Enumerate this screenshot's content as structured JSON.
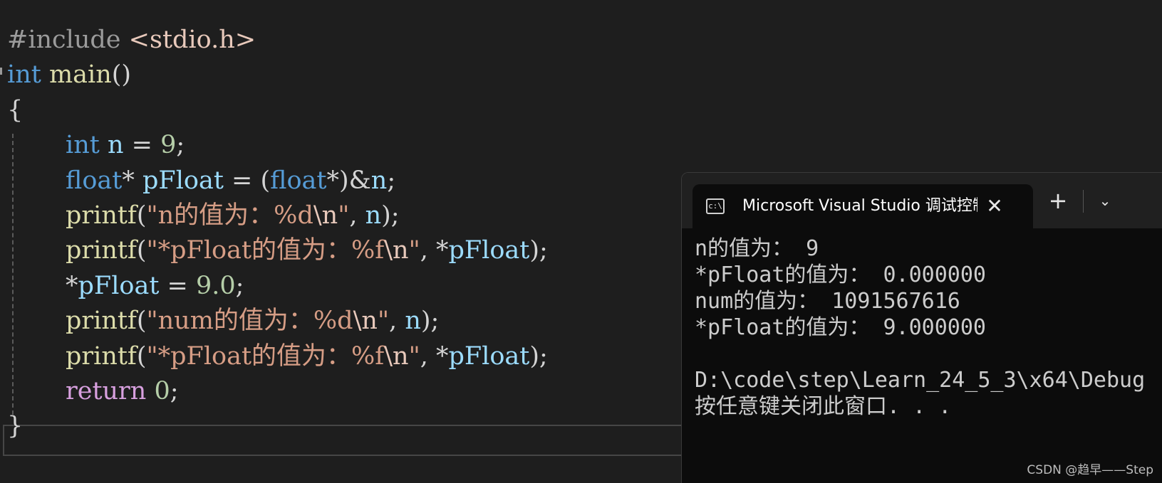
{
  "editor": {
    "lines": [
      {
        "tokens": [
          {
            "c": "pp",
            "t": "#include "
          },
          {
            "c": "inc",
            "t": "<stdio.h>"
          }
        ]
      },
      {
        "tokens": [
          {
            "c": "kw",
            "t": "int"
          },
          {
            "c": "pun",
            "t": " "
          },
          {
            "c": "fn",
            "t": "main"
          },
          {
            "c": "pun",
            "t": "()"
          }
        ]
      },
      {
        "tokens": [
          {
            "c": "pun",
            "t": "{"
          }
        ]
      },
      {
        "indent": true,
        "tokens": [
          {
            "c": "kw",
            "t": "int"
          },
          {
            "c": "pun",
            "t": " "
          },
          {
            "c": "var",
            "t": "n"
          },
          {
            "c": "pun",
            "t": " = "
          },
          {
            "c": "num",
            "t": "9"
          },
          {
            "c": "pun",
            "t": ";"
          }
        ]
      },
      {
        "indent": true,
        "tokens": [
          {
            "c": "kw",
            "t": "float"
          },
          {
            "c": "pun",
            "t": "* "
          },
          {
            "c": "var",
            "t": "pFloat"
          },
          {
            "c": "pun",
            "t": " = ("
          },
          {
            "c": "kw",
            "t": "float"
          },
          {
            "c": "pun",
            "t": "*)&"
          },
          {
            "c": "var",
            "t": "n"
          },
          {
            "c": "pun",
            "t": ";"
          }
        ]
      },
      {
        "indent": true,
        "tokens": [
          {
            "c": "fn",
            "t": "printf"
          },
          {
            "c": "pun",
            "t": "("
          },
          {
            "c": "str",
            "t": "\"n的值为：%d"
          },
          {
            "c": "esc",
            "t": "\\n"
          },
          {
            "c": "str",
            "t": "\""
          },
          {
            "c": "pun",
            "t": ", "
          },
          {
            "c": "var",
            "t": "n"
          },
          {
            "c": "pun",
            "t": ");"
          }
        ]
      },
      {
        "indent": true,
        "tokens": [
          {
            "c": "fn",
            "t": "printf"
          },
          {
            "c": "pun",
            "t": "("
          },
          {
            "c": "str",
            "t": "\"*pFloat的值为：%f"
          },
          {
            "c": "esc",
            "t": "\\n"
          },
          {
            "c": "str",
            "t": "\""
          },
          {
            "c": "pun",
            "t": ", *"
          },
          {
            "c": "var",
            "t": "pFloat"
          },
          {
            "c": "pun",
            "t": ");"
          }
        ]
      },
      {
        "indent": true,
        "tokens": [
          {
            "c": "pun",
            "t": "*"
          },
          {
            "c": "var",
            "t": "pFloat"
          },
          {
            "c": "pun",
            "t": " = "
          },
          {
            "c": "num",
            "t": "9.0"
          },
          {
            "c": "pun",
            "t": ";"
          }
        ]
      },
      {
        "indent": true,
        "tokens": [
          {
            "c": "fn",
            "t": "printf"
          },
          {
            "c": "pun",
            "t": "("
          },
          {
            "c": "str",
            "t": "\"num的值为：%d"
          },
          {
            "c": "esc",
            "t": "\\n"
          },
          {
            "c": "str",
            "t": "\""
          },
          {
            "c": "pun",
            "t": ", "
          },
          {
            "c": "var",
            "t": "n"
          },
          {
            "c": "pun",
            "t": ");"
          }
        ]
      },
      {
        "indent": true,
        "tokens": [
          {
            "c": "fn",
            "t": "printf"
          },
          {
            "c": "pun",
            "t": "("
          },
          {
            "c": "str",
            "t": "\"*pFloat的值为：%f"
          },
          {
            "c": "esc",
            "t": "\\n"
          },
          {
            "c": "str",
            "t": "\""
          },
          {
            "c": "pun",
            "t": ", *"
          },
          {
            "c": "var",
            "t": "pFloat"
          },
          {
            "c": "pun",
            "t": ");"
          }
        ]
      },
      {
        "indent": true,
        "tokens": [
          {
            "c": "ctl",
            "t": "return"
          },
          {
            "c": "pun",
            "t": " "
          },
          {
            "c": "num",
            "t": "0"
          },
          {
            "c": "pun",
            "t": ";"
          }
        ]
      },
      {
        "tokens": [
          {
            "c": "pun",
            "t": "}"
          }
        ]
      }
    ]
  },
  "terminal": {
    "tab_title": "Microsoft Visual Studio 调试控制台",
    "tab_icon_text": "c:\\",
    "close_glyph": "✕",
    "new_tab_glyph": "+",
    "dropdown_glyph": "⌄",
    "output_lines": [
      "n的值为： 9",
      "*pFloat的值为： 0.000000",
      "num的值为： 1091567616",
      "*pFloat的值为： 9.000000",
      "",
      "D:\\code\\step\\Learn_24_5_3\\x64\\Debug",
      "按任意键关闭此窗口. . ."
    ]
  },
  "watermark": "CSDN @趋早——Step",
  "colors": {
    "editor_bg": "#1e1e1e",
    "keyword": "#569cd6",
    "function": "#dcdcaa",
    "string": "#d69d85",
    "number": "#b5cea8",
    "variable": "#9cdcfe",
    "control": "#d8a0df",
    "terminal_bg": "#0c0c0c"
  }
}
